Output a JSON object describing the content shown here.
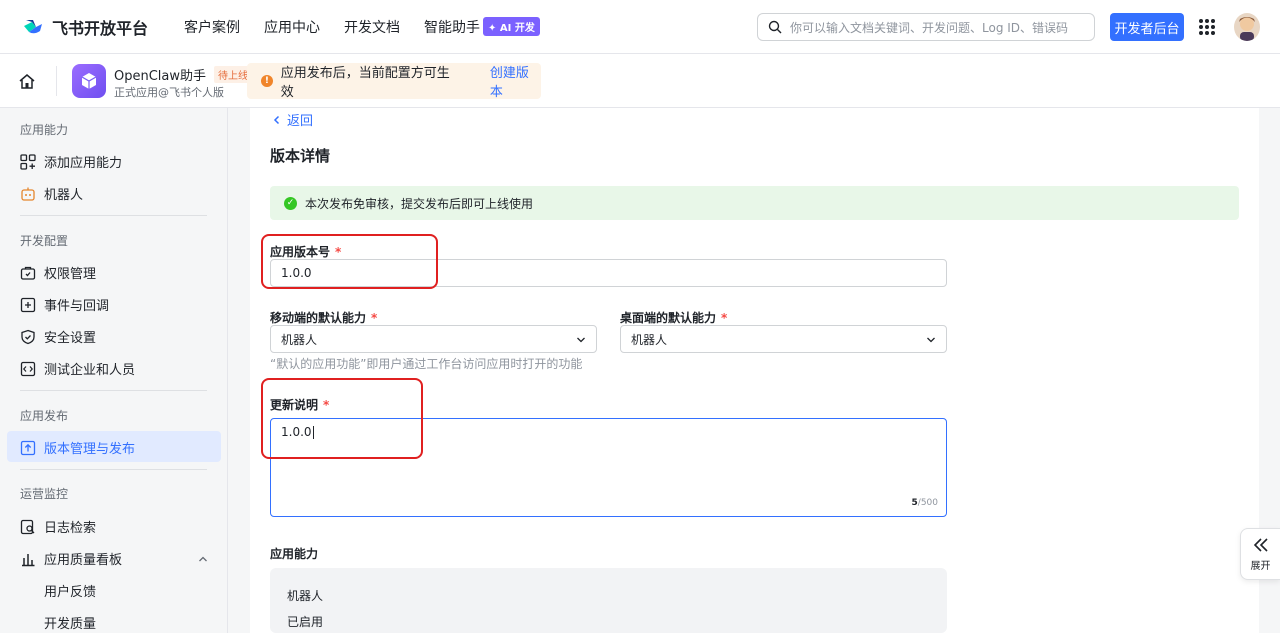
{
  "topnav": {
    "brand": "飞书开放平台",
    "links": [
      "客户案例",
      "应用中心",
      "开发文档",
      "智能助手"
    ],
    "ai_badge": "✦ AI 开发",
    "search_placeholder": "你可以输入文档关键词、开发问题、Log ID、错误码",
    "dev_button": "开发者后台"
  },
  "appbar": {
    "app_name": "OpenClaw助手",
    "app_tag": "待上线",
    "app_sub": "正式应用@飞书个人版",
    "notice": "应用发布后，当前配置方可生效",
    "notice_link": "创建版本"
  },
  "sidebar": {
    "sections": [
      {
        "title": "应用能力",
        "items": [
          "添加应用能力",
          "机器人"
        ]
      },
      {
        "title": "开发配置",
        "items": [
          "权限管理",
          "事件与回调",
          "安全设置",
          "测试企业和人员"
        ]
      },
      {
        "title": "应用发布",
        "items": [
          "版本管理与发布"
        ]
      },
      {
        "title": "运营监控",
        "items": [
          "日志检索",
          "应用质量看板"
        ]
      }
    ],
    "sub_items": [
      "用户反馈",
      "开发质量"
    ],
    "active": "版本管理与发布"
  },
  "main": {
    "back": "返回",
    "title": "版本详情",
    "success": "本次发布免审核，提交发布后即可上线使用",
    "version_label": "应用版本号",
    "version_value": "1.0.0",
    "mobile_label": "移动端的默认能力",
    "mobile_value": "机器人",
    "desktop_label": "桌面端的默认能力",
    "desktop_value": "机器人",
    "hint": "“默认的应用功能”即用户通过工作台访问应用时打开的功能",
    "notes_label": "更新说明",
    "notes_value": "1.0.0",
    "counter_current": "5",
    "counter_max": "/500",
    "capabilities_label": "应用能力",
    "capability_name": "机器人",
    "capability_state": "已启用",
    "required_mark": "*"
  },
  "expand_label": "展开",
  "colors": {
    "accent": "#3370ff",
    "highlight": "#e02020",
    "success_bg": "#e8f7e8",
    "warning_bg": "#fdf3e7"
  }
}
